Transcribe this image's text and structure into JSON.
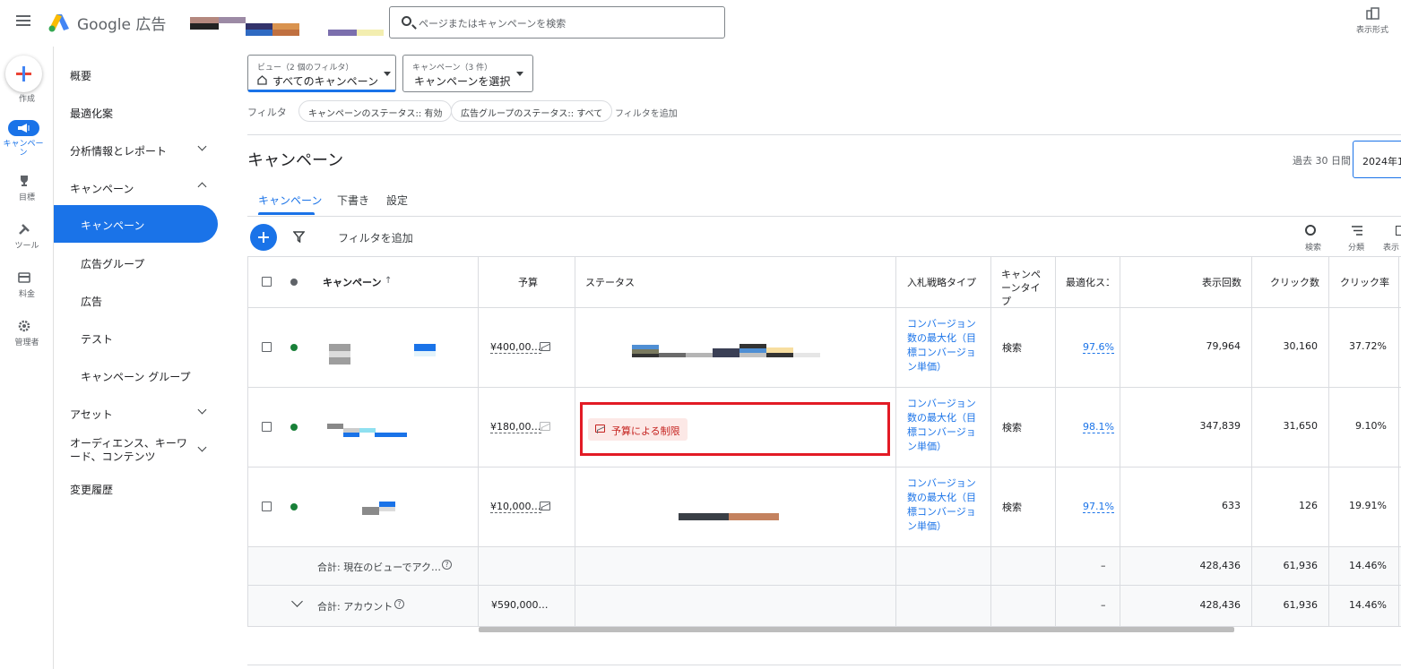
{
  "app": {
    "brand": "Google 広告"
  },
  "search": {
    "placeholder": "ページまたはキャンペーンを検索"
  },
  "header": {
    "view_label": "表示形式"
  },
  "rail": {
    "create": "作成",
    "campaign": "キャンペーン",
    "goals": "目標",
    "tools": "ツール",
    "billing": "料金",
    "admin": "管理者"
  },
  "nav": {
    "overview": "概要",
    "recommendations": "最適化案",
    "insights": "分析情報とレポート",
    "campaigns_group": "キャンペーン",
    "campaigns": "キャンペーン",
    "ad_groups": "広告グループ",
    "ads": "広告",
    "experiments": "テスト",
    "campaign_groups": "キャンペーン グループ",
    "assets": "アセット",
    "audiences": "オーディエンス、キーワード、コンテンツ",
    "change_history": "変更履歴"
  },
  "filters": {
    "view_label": "ビュー（2 個のフィルタ）",
    "view_value": "すべてのキャンペーン",
    "campaign_label": "キャンペーン（3 件）",
    "campaign_value": "キャンペーンを選択",
    "filter_label": "フィルタ",
    "chips": [
      "キャンペーンのステータス:: 有効",
      "広告グループのステータス:: すべて"
    ],
    "add_filter": "フィルタを追加"
  },
  "page": {
    "title": "キャンペーン",
    "date_range_label": "過去 30 日間",
    "date_value": "2024年1",
    "tabs": [
      "キャンペーン",
      "下書き",
      "設定"
    ]
  },
  "toolbar": {
    "add_filter": "フィルタを追加",
    "search": "検索",
    "segment": "分類",
    "columns": "表示"
  },
  "table": {
    "headers": {
      "campaign": "キャンペーン",
      "budget": "予算",
      "status": "ステータス",
      "bid_strategy": "入札戦略タイプ",
      "campaign_type": "キャンペーンタイプ",
      "opt_score": "最適化スコ",
      "impressions": "表示回数",
      "clicks": "クリック数",
      "ctr": "クリック率"
    },
    "rows": [
      {
        "budget": "¥400,00…",
        "status": "",
        "bid": "コンバージョン数の最大化（目標コンバージョン単価）",
        "type": "検索",
        "opt": "97.6%",
        "impressions": "79,964",
        "clicks": "30,160",
        "ctr": "37.72%"
      },
      {
        "budget": "¥180,00…",
        "status": "予算による制限",
        "bid": "コンバージョン数の最大化（目標コンバージョン単価）",
        "type": "検索",
        "opt": "98.1%",
        "impressions": "347,839",
        "clicks": "31,650",
        "ctr": "9.10%"
      },
      {
        "budget": "¥10,000…",
        "status": "",
        "bid": "コンバージョン数の最大化（目標コンバージョン単価）",
        "type": "検索",
        "opt": "97.1%",
        "impressions": "633",
        "clicks": "126",
        "ctr": "19.91%"
      }
    ],
    "total_view": {
      "label": "合計: 現在のビューでアク…",
      "opt": "–",
      "impressions": "428,436",
      "clicks": "61,936",
      "ctr": "14.46%"
    },
    "total_account": {
      "label": "合計: アカウント",
      "budget": "¥590,000…",
      "opt": "–",
      "impressions": "428,436",
      "clicks": "61,936",
      "ctr": "14.46%"
    }
  },
  "colors": {
    "accent": "#1a73e8",
    "status_green": "#188038",
    "alert_red": "#e21b25"
  }
}
